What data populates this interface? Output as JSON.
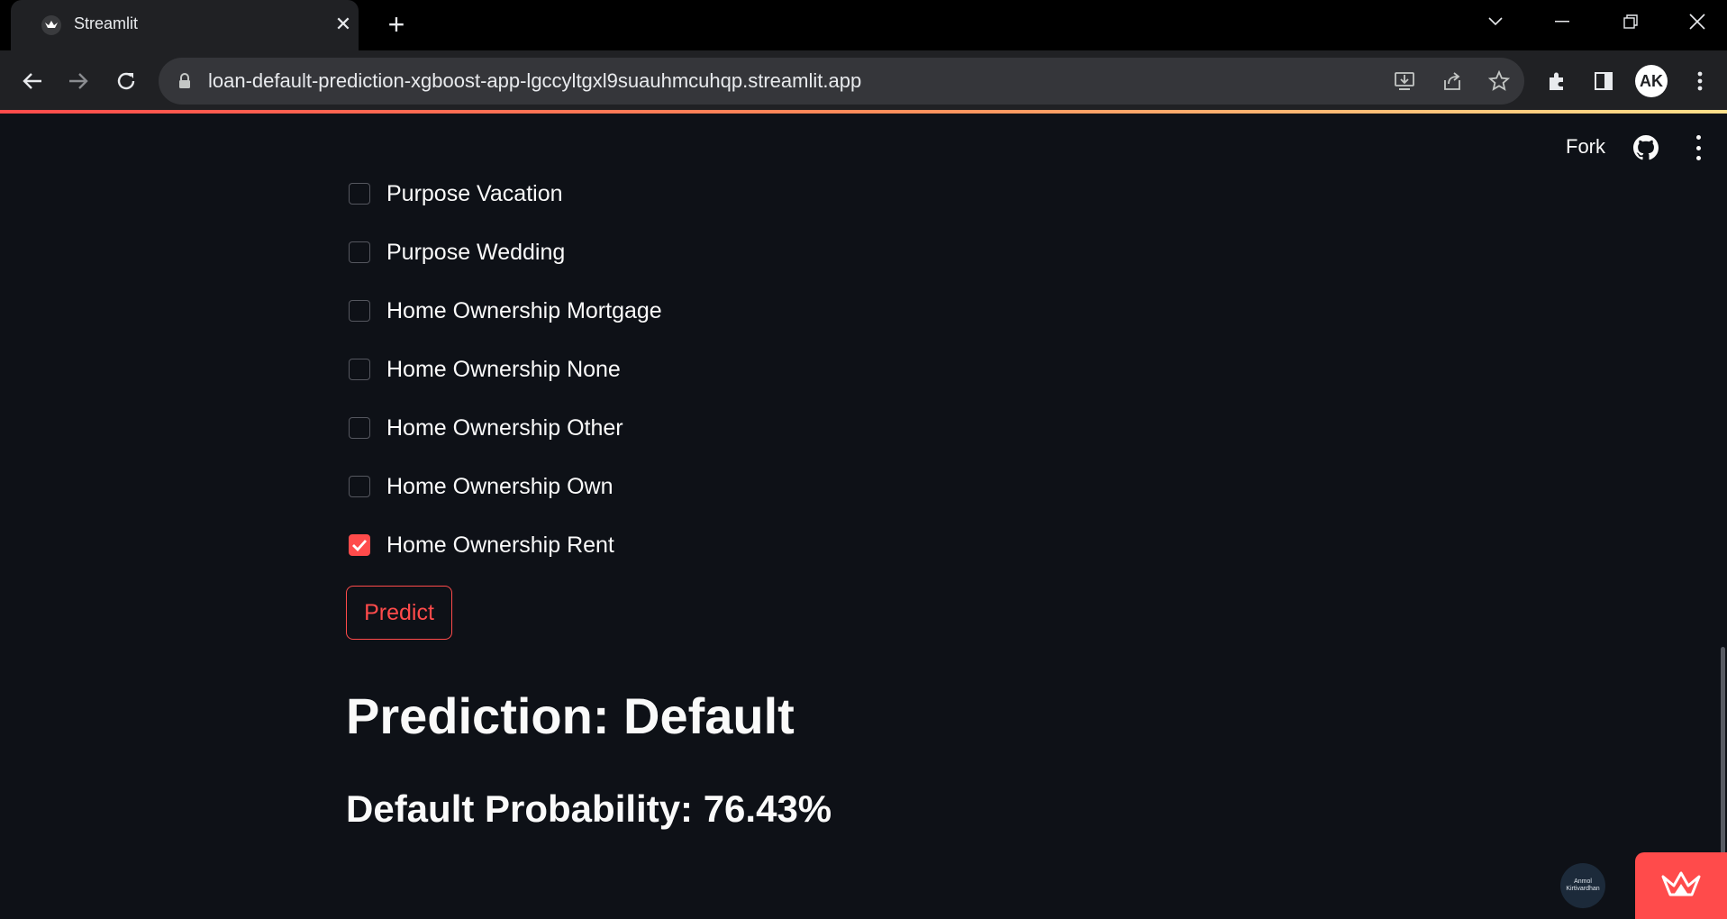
{
  "browser": {
    "tab_title": "Streamlit",
    "url": "loan-default-prediction-xgboost-app-lgccyltgxl9suauhmcuhqp.streamlit.app",
    "avatar_initials": "AK"
  },
  "header": {
    "fork_label": "Fork"
  },
  "checkboxes": [
    {
      "label": "Purpose Vacation",
      "checked": false
    },
    {
      "label": "Purpose Wedding",
      "checked": false
    },
    {
      "label": "Home Ownership Mortgage",
      "checked": false
    },
    {
      "label": "Home Ownership None",
      "checked": false
    },
    {
      "label": "Home Ownership Other",
      "checked": false
    },
    {
      "label": "Home Ownership Own",
      "checked": false
    },
    {
      "label": "Home Ownership Rent",
      "checked": true
    }
  ],
  "predict_button": "Predict",
  "result": {
    "prediction": "Prediction: Default",
    "probability": "Default Probability: 76.43%"
  },
  "badge": {
    "line1": "Anmol",
    "line2": "Kirtivardhan"
  },
  "colors": {
    "accent": "#ff4b4b",
    "background": "#0e1117",
    "text": "#fafafa"
  }
}
